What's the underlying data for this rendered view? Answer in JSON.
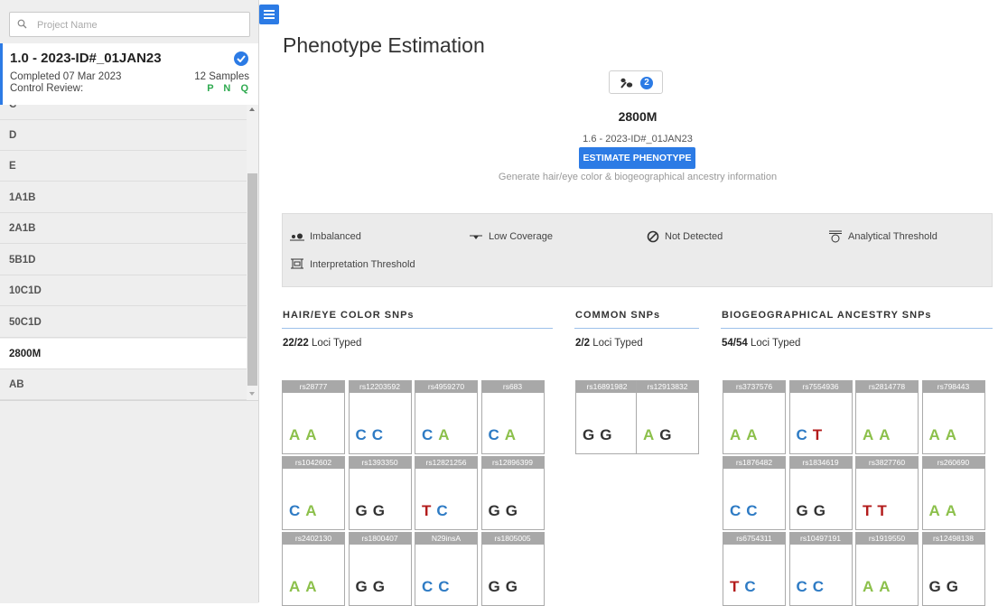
{
  "sidebar": {
    "search_placeholder": "Project Name",
    "project": {
      "title": "1.0 - 2023-ID#_01JAN23",
      "completed": "Completed 07 Mar 2023",
      "samples": "12 Samples",
      "control_label": "Control Review:",
      "control_flags": [
        "P",
        "N",
        "Q"
      ]
    },
    "samples": [
      "C",
      "D",
      "E",
      "1A1B",
      "2A1B",
      "5B1D",
      "10C1D",
      "50C1D",
      "2800M",
      "AB"
    ],
    "selected_sample": "2800M"
  },
  "main": {
    "title": "Phenotype Estimation",
    "badge_count": "2",
    "sample_name": "2800M",
    "sample_project": "1.6 - 2023-ID#_01JAN23",
    "estimate_button": "ESTIMATE PHENOTYPE",
    "estimate_description": "Generate hair/eye color & biogeographical ancestry information",
    "legend": {
      "imbalanced": "Imbalanced",
      "low_coverage": "Low Coverage",
      "not_detected": "Not Detected",
      "analytical_threshold": "Analytical Threshold",
      "interpretation_threshold": "Interpretation Threshold"
    },
    "colors": {
      "A": "#8cc04b",
      "C": "#2e7bc4",
      "G": "#333333",
      "T": "#b31b1b",
      "accent": "#2c7be5"
    },
    "sections": {
      "hair_eye": {
        "title": "HAIR/EYE COLOR SNPs",
        "loci_count": "22/22",
        "loci_text": " Loci Typed",
        "snps": [
          {
            "id": "rs28777",
            "a1": "A",
            "a2": "A"
          },
          {
            "id": "rs12203592",
            "a1": "C",
            "a2": "C"
          },
          {
            "id": "rs4959270",
            "a1": "C",
            "a2": "A"
          },
          {
            "id": "rs683",
            "a1": "C",
            "a2": "A"
          },
          {
            "id": "rs1042602",
            "a1": "C",
            "a2": "A"
          },
          {
            "id": "rs1393350",
            "a1": "G",
            "a2": "G"
          },
          {
            "id": "rs12821256",
            "a1": "T",
            "a2": "C"
          },
          {
            "id": "rs12896399",
            "a1": "G",
            "a2": "G"
          },
          {
            "id": "rs2402130",
            "a1": "A",
            "a2": "A"
          },
          {
            "id": "rs1800407",
            "a1": "G",
            "a2": "G"
          },
          {
            "id": "N29insA",
            "a1": "C",
            "a2": "C"
          },
          {
            "id": "rs1805005",
            "a1": "G",
            "a2": "G"
          }
        ]
      },
      "common": {
        "title": "COMMON SNPs",
        "loci_count": "2/2",
        "loci_text": " Loci Typed",
        "snps": [
          {
            "id": "rs16891982",
            "a1": "G",
            "a2": "G"
          },
          {
            "id": "rs12913832",
            "a1": "A",
            "a2": "G"
          }
        ]
      },
      "ancestry": {
        "title": "BIOGEOGRAPHICAL ANCESTRY SNPs",
        "loci_count": "54/54",
        "loci_text": " Loci Typed",
        "snps": [
          {
            "id": "rs3737576",
            "a1": "A",
            "a2": "A"
          },
          {
            "id": "rs7554936",
            "a1": "C",
            "a2": "T"
          },
          {
            "id": "rs2814778",
            "a1": "A",
            "a2": "A"
          },
          {
            "id": "rs798443",
            "a1": "A",
            "a2": "A"
          },
          {
            "id": "rs1876482",
            "a1": "C",
            "a2": "C"
          },
          {
            "id": "rs1834619",
            "a1": "G",
            "a2": "G"
          },
          {
            "id": "rs3827760",
            "a1": "T",
            "a2": "T"
          },
          {
            "id": "rs260690",
            "a1": "A",
            "a2": "A"
          },
          {
            "id": "rs6754311",
            "a1": "T",
            "a2": "C"
          },
          {
            "id": "rs10497191",
            "a1": "C",
            "a2": "C"
          },
          {
            "id": "rs1919550",
            "a1": "A",
            "a2": "A"
          },
          {
            "id": "rs12498138",
            "a1": "G",
            "a2": "G"
          }
        ]
      }
    }
  }
}
